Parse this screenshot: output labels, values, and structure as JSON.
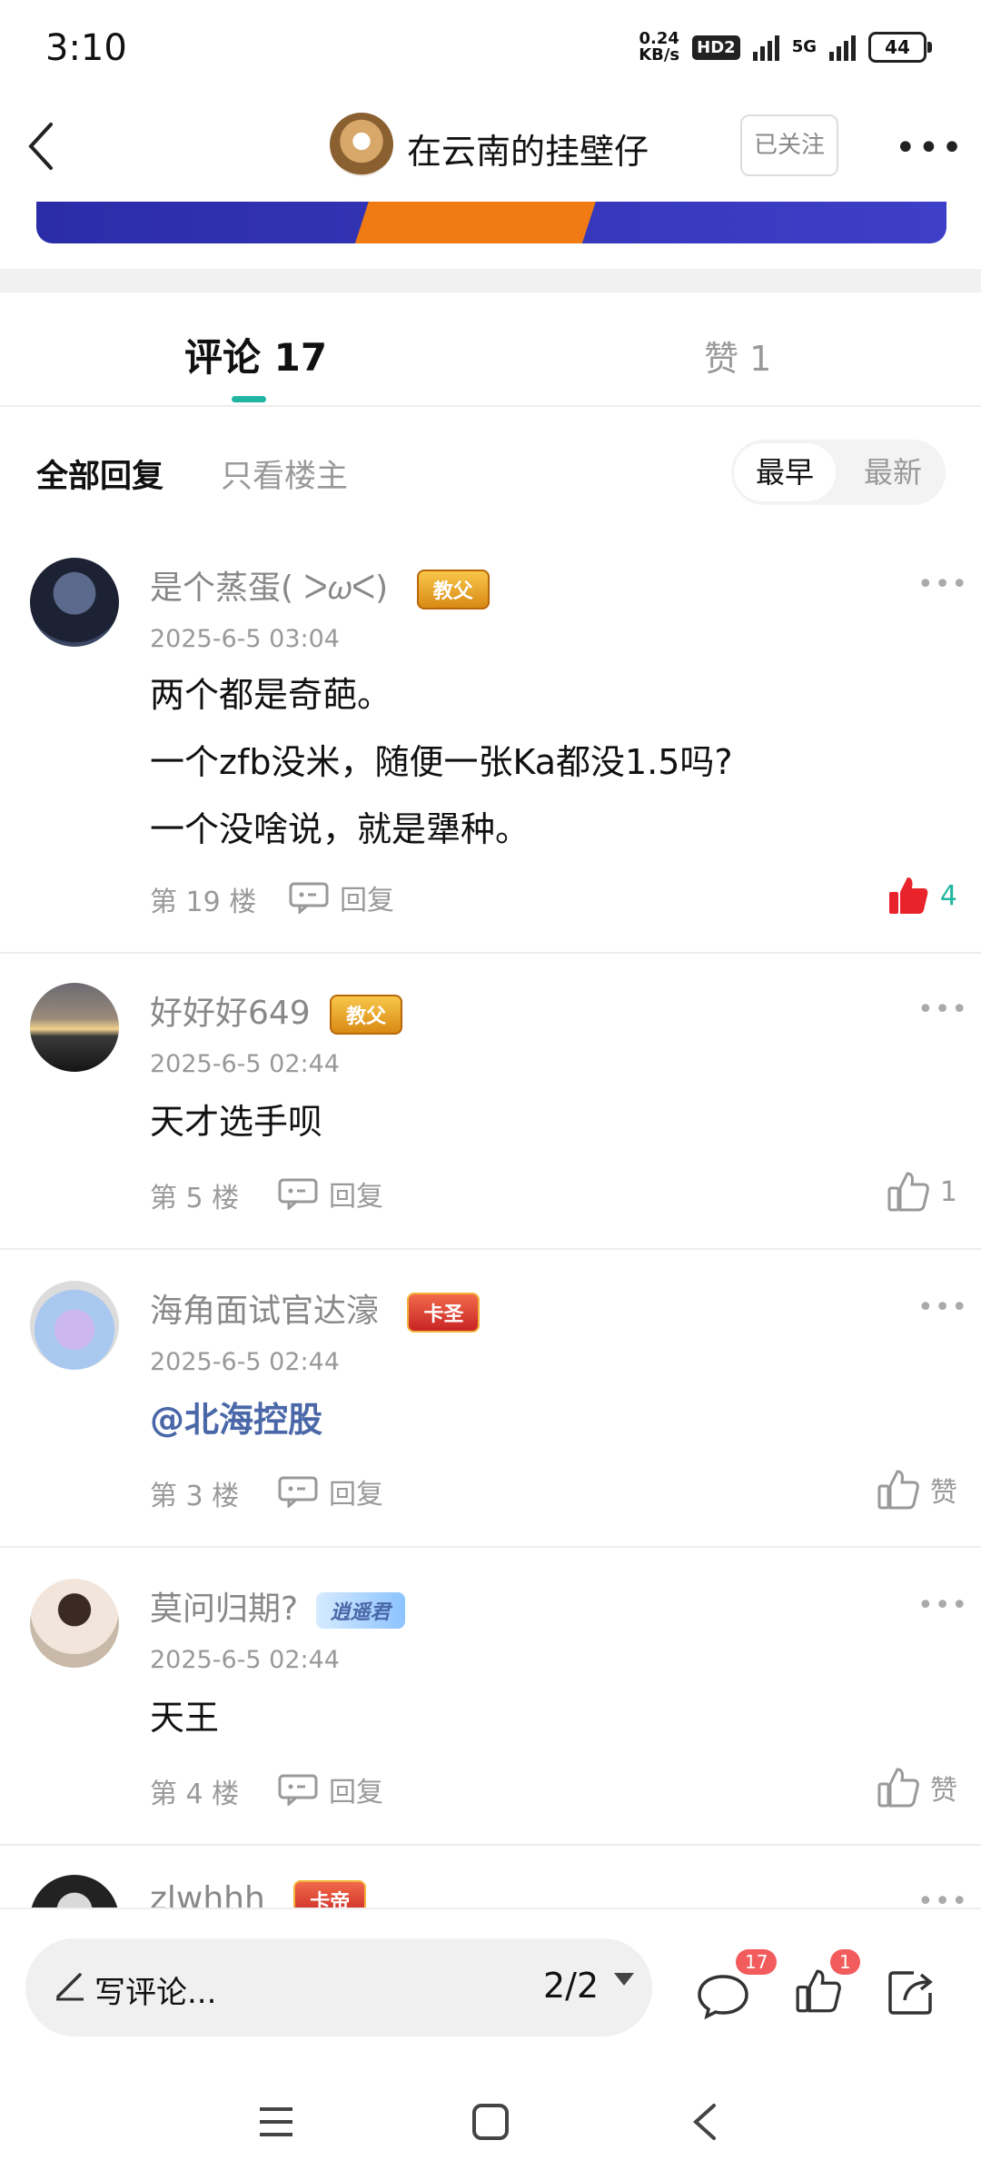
{
  "status_bar": {
    "time": "3:10",
    "net_speed_value": "0.24",
    "net_speed_unit": "KB/s",
    "hd_label": "HD2",
    "network_label": "5G",
    "battery": "44"
  },
  "header": {
    "author_name": "在云南的挂壁仔",
    "follow_label": "已关注"
  },
  "tabs": {
    "comments": "评论 17",
    "likes": "赞 1"
  },
  "filters": {
    "all": "全部回复",
    "op_only": "只看楼主",
    "sort_early": "最早",
    "sort_new": "最新"
  },
  "comments": [
    {
      "name": "是个蒸蛋( ᐳ𝜔ᐸ)",
      "badge": "教父",
      "time": "2025-6-5 03:04",
      "lines": [
        "两个都是奇葩。",
        "一个zfb没米，随便一张Ka都没1.5吗?",
        "一个没啥说，就是犟种。"
      ],
      "floor": "第 19 楼",
      "reply": "回复",
      "likes": "4"
    },
    {
      "name": "好好好649",
      "badge": "教父",
      "time": "2025-6-5 02:44",
      "lines": [
        "天才选手呗"
      ],
      "floor": "第 5 楼",
      "reply": "回复",
      "likes": "1"
    },
    {
      "name": "海角面试官达濠",
      "badge": "卡圣",
      "time": "2025-6-5 02:44",
      "lines": [
        "@北海控股"
      ],
      "floor": "第 3 楼",
      "reply": "回复",
      "likes": "赞"
    },
    {
      "name": "莫问归期?",
      "badge": "逍遥君",
      "time": "2025-6-5 02:44",
      "lines": [
        "天王"
      ],
      "floor": "第 4 楼",
      "reply": "回复",
      "likes": "赞"
    },
    {
      "name": "zlwhhh",
      "badge": "卡帝"
    }
  ],
  "bottom_bar": {
    "write_placeholder": "写评论...",
    "page": "2/2",
    "comment_count": "17",
    "like_count": "1"
  },
  "colors": {
    "accent": "#1fb5a0",
    "like_red": "#e8232a",
    "badge_red": "#f25c5c"
  }
}
